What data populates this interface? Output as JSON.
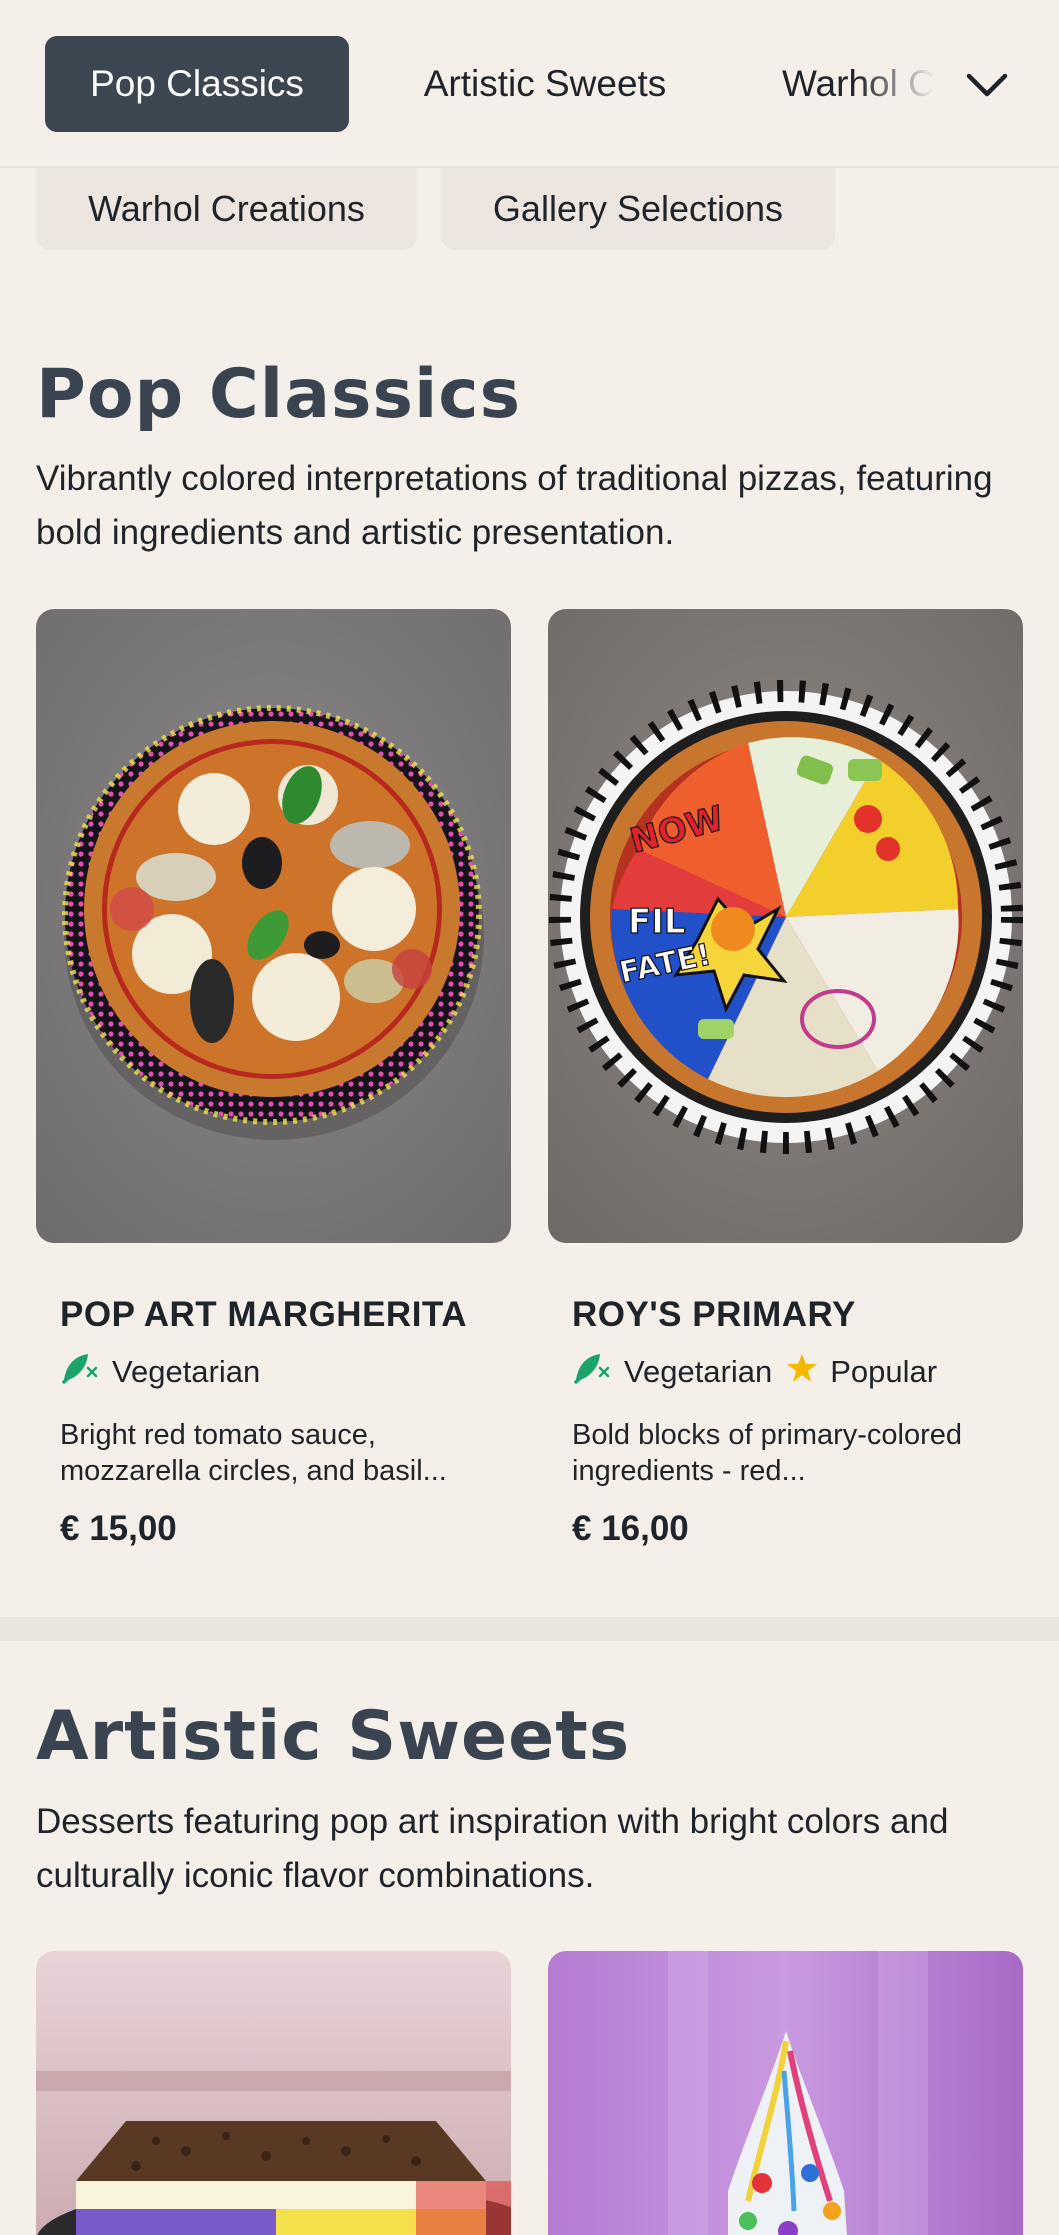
{
  "nav": {
    "tabs": [
      {
        "label": "Pop Classics",
        "active": true
      },
      {
        "label": "Artistic Sweets",
        "active": false
      },
      {
        "label": "Warhol C",
        "active": false
      }
    ],
    "overflow_icon": "chevron-down-icon",
    "chips": [
      {
        "label": "Warhol Creations"
      },
      {
        "label": "Gallery Selections"
      }
    ]
  },
  "sections": [
    {
      "title": "Pop Classics",
      "description": "Vibrantly colored interpretations of traditional pizzas, featuring bold ingredients and artistic presentation.",
      "items": [
        {
          "name": "POP ART MARGHERITA",
          "tags": [
            {
              "icon": "vegetarian-icon",
              "label": "Vegetarian"
            }
          ],
          "description": "Bright red tomato sauce, mozzarella circles, and basil...",
          "price": "€ 15,00"
        },
        {
          "name": "ROY'S PRIMARY",
          "tags": [
            {
              "icon": "vegetarian-icon",
              "label": "Vegetarian"
            },
            {
              "icon": "star-icon",
              "label": "Popular"
            }
          ],
          "description": "Bold blocks of primary-colored ingredients - red...",
          "price": "€ 16,00"
        }
      ]
    },
    {
      "title": "Artistic Sweets",
      "description": "Desserts featuring pop art inspiration with bright colors and culturally iconic flavor combinations.",
      "items": [
        {
          "image": "dessert-cake-image"
        },
        {
          "image": "soft-serve-image"
        }
      ]
    }
  ],
  "colors": {
    "background": "#f5efea",
    "active_tab": "#3b4651",
    "heading": "#3a4450",
    "vegetarian": "#1aa46a",
    "star": "#f5b800"
  }
}
